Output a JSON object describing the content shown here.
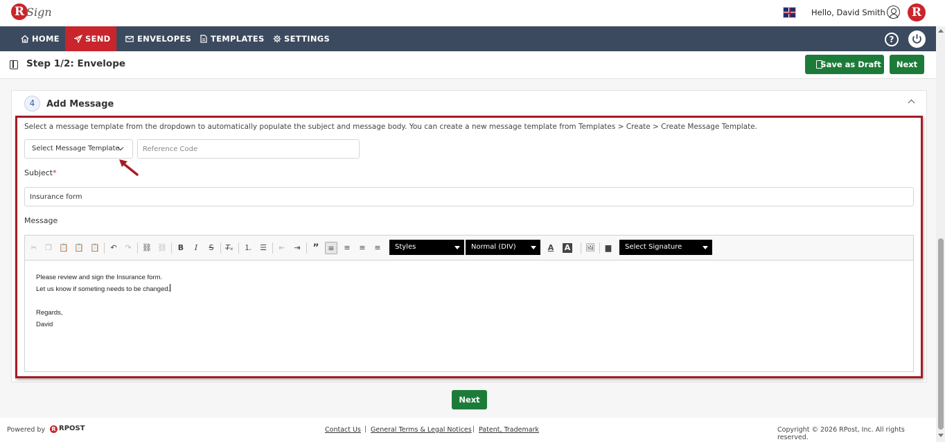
{
  "header": {
    "logo_letter": "R",
    "logo_text": "Sign",
    "greeting": "Hello, David Smith",
    "avatar_letter": "R"
  },
  "nav": {
    "items": [
      {
        "label": "HOME",
        "icon": "home-icon"
      },
      {
        "label": "SEND",
        "icon": "send-icon",
        "active": true
      },
      {
        "label": "ENVELOPES",
        "icon": "envelope-icon"
      },
      {
        "label": "TEMPLATES",
        "icon": "template-icon"
      },
      {
        "label": "SETTINGS",
        "icon": "gear-icon"
      }
    ],
    "help_label": "?"
  },
  "stepbar": {
    "title": "Step 1/2: Envelope",
    "save_draft_label": "Save as Draft",
    "next_label": "Next"
  },
  "section": {
    "number": "4",
    "title": "Add Message",
    "instructions": "Select a message template from the dropdown to automatically populate the subject and message body. You can create a new message template from Templates > Create > Create Message Template.",
    "template_select_value": "Select Message Template",
    "reference_placeholder": "Reference Code",
    "subject_label": "Subject",
    "subject_required": "*",
    "subject_value": "Insurance form",
    "message_label": "Message",
    "toolbar": {
      "styles_label": "Styles",
      "format_label": "Normal (DIV)",
      "signature_label": "Select Signature"
    },
    "message_lines": [
      "Please review and sign the Insurance form.",
      "Let us know if someting needs to be changed.",
      "",
      "Regards,",
      "David"
    ],
    "next_label": "Next"
  },
  "footer": {
    "powered_by": "Powered by",
    "brand": "RPOST",
    "links": [
      "Contact Us",
      "General Terms & Legal Notices",
      "Patent, Trademark"
    ],
    "separator": "|",
    "copyright": "Copyright © 2026 RPost, Inc. All rights reserved."
  },
  "colors": {
    "brand_red": "#c9252c",
    "nav_bg": "#3b4a5e",
    "action_green": "#1d7b39",
    "highlight": "#a51c24"
  }
}
